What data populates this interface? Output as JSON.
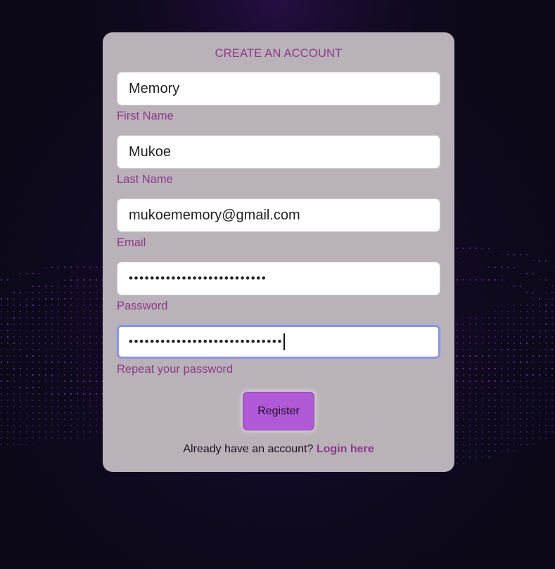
{
  "colors": {
    "page_background": "#0c0818",
    "card_background": "#b9b2b9",
    "accent": "#8e3a8a",
    "button": "#b05ad8",
    "focus_ring": "#8e96d6"
  },
  "form": {
    "title": "CREATE AN ACCOUNT",
    "fields": [
      {
        "label": "First Name",
        "value": "Memory",
        "type": "text"
      },
      {
        "label": "Last Name",
        "value": "Mukoe",
        "type": "text"
      },
      {
        "label": "Email",
        "value": "mukoememory@gmail.com",
        "type": "email"
      },
      {
        "label": "Password",
        "value": "••••••••••••••••••••••••••",
        "type": "password"
      },
      {
        "label": "Repeat your password",
        "value": "•••••••••••••••••••••••••••••",
        "type": "password",
        "focused": true
      }
    ],
    "register_label": "Register",
    "login_prompt": "Already have an account?",
    "login_link": "Login here"
  }
}
